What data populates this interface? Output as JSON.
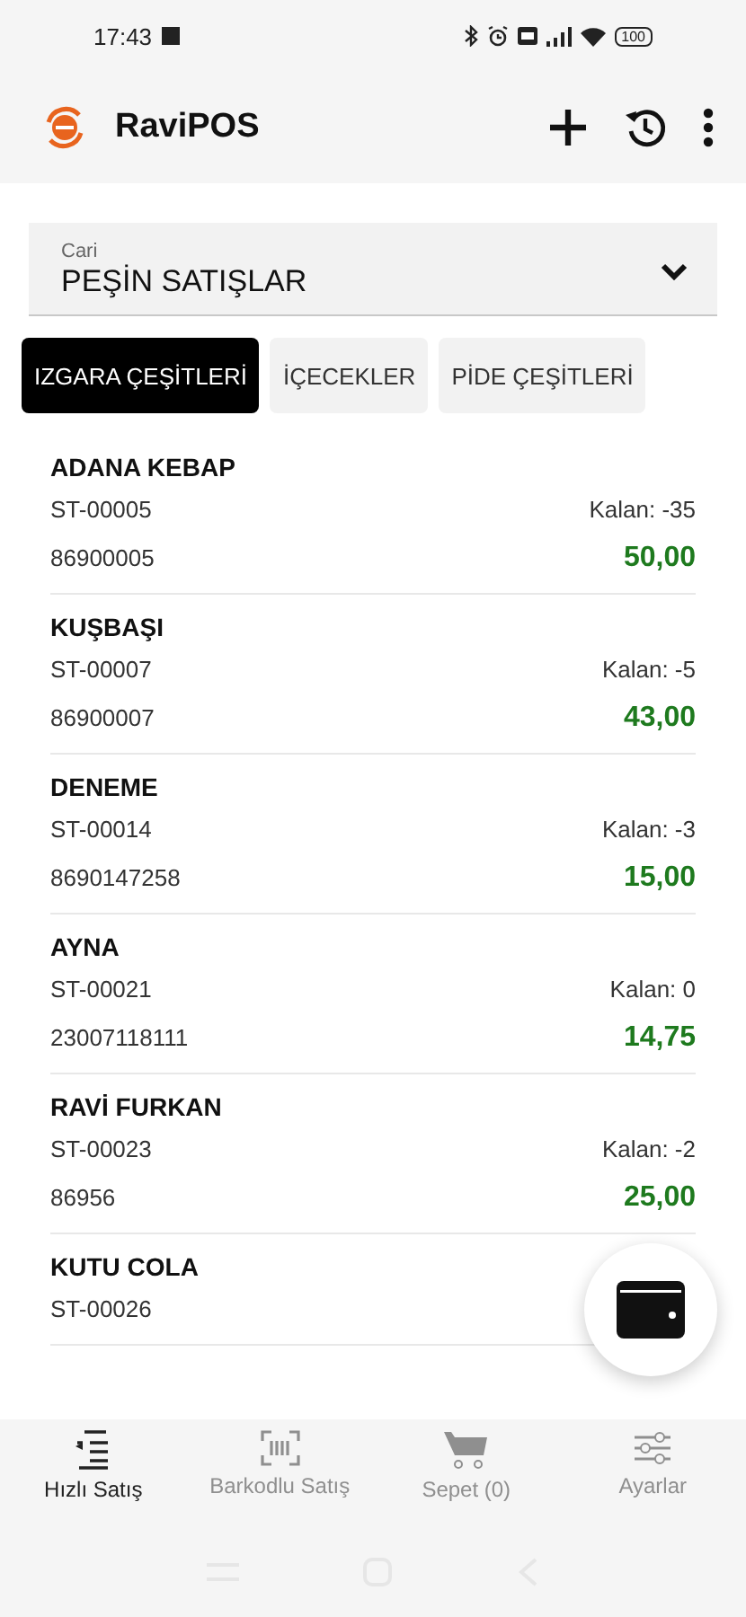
{
  "status_bar": {
    "time": "17:43",
    "battery": "100"
  },
  "app_bar": {
    "title": "RaviPOS"
  },
  "cari_field": {
    "label": "Cari",
    "value": "PEŞİN SATIŞLAR"
  },
  "tabs": [
    {
      "label": "IZGARA ÇEŞİTLERİ",
      "selected": true
    },
    {
      "label": "İÇECEKLER",
      "selected": false
    },
    {
      "label": "PİDE ÇEŞİTLERİ",
      "selected": false
    }
  ],
  "products": [
    {
      "name": "ADANA KEBAP",
      "code": "ST-00005",
      "stock": "Kalan: -35",
      "barcode": "86900005",
      "price": "50,00"
    },
    {
      "name": "KUŞBAŞI",
      "code": "ST-00007",
      "stock": "Kalan: -5",
      "barcode": "86900007",
      "price": "43,00"
    },
    {
      "name": "DENEME",
      "code": "ST-00014",
      "stock": "Kalan: -3",
      "barcode": "8690147258",
      "price": "15,00"
    },
    {
      "name": "AYNA",
      "code": "ST-00021",
      "stock": "Kalan: 0",
      "barcode": "23007118111",
      "price": "14,75"
    },
    {
      "name": "RAVİ FURKAN",
      "code": "ST-00023",
      "stock": "Kalan: -2",
      "barcode": "86956",
      "price": "25,00"
    },
    {
      "name": "KUTU COLA",
      "code": "ST-00026"
    }
  ],
  "bottom_nav": [
    {
      "kind": "quick",
      "label": "Hızlı Satış",
      "selected": true
    },
    {
      "kind": "barcode",
      "label": "Barkodlu Satış",
      "selected": false
    },
    {
      "kind": "cart",
      "label": "Sepet (0)",
      "selected": false
    },
    {
      "kind": "settings",
      "label": "Ayarlar",
      "selected": false
    }
  ]
}
